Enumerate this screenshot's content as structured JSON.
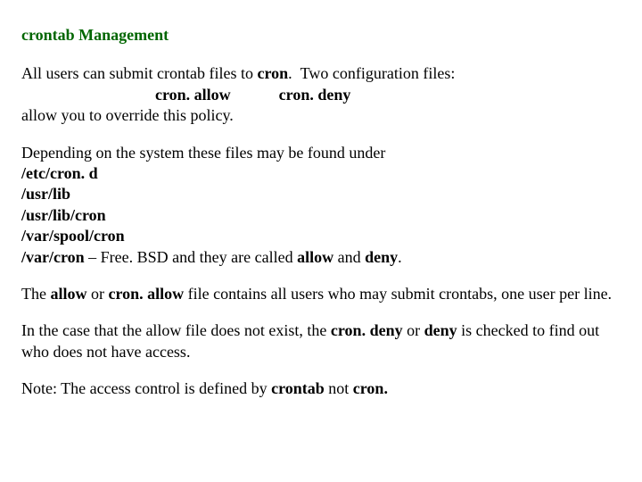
{
  "heading": "crontab Management",
  "p1_a": "All users can submit crontab files to ",
  "p1_b_bold": "cron",
  "p1_c": ".  Two configuration files:",
  "p1_indent_a": "cron. allow",
  "p1_indent_gap": "            ",
  "p1_indent_b": "cron. deny",
  "p1_d": "allow you to override this policy.",
  "p2": "Depending on the system these files may be found under",
  "paths": {
    "a": "/etc/cron. d",
    "b": "/usr/lib",
    "c": "/usr/lib/cron",
    "d": "/var/spool/cron",
    "e_lead": "/var/cron",
    "e_tail": " – Free. BSD and they are called ",
    "e_tail2": "allow",
    "e_tail3": " and ",
    "e_tail4": "deny",
    "e_tail5": "."
  },
  "p3_a": "The ",
  "p3_b": "allow",
  "p3_c": " or ",
  "p3_d": "cron. allow",
  "p3_e": " file contains all users who may submit crontabs, one user per line.",
  "p4_a": "In the case that the allow file does not exist, the ",
  "p4_b": "cron. deny",
  "p4_c": " or ",
  "p4_d": "deny",
  "p4_e": " is checked to find out who does not have access.",
  "p5_a": "Note: The access control is defined by ",
  "p5_b": "crontab",
  "p5_c": " not ",
  "p5_d": "cron.",
  "colors": {
    "heading": "#006600",
    "text": "#000000"
  }
}
